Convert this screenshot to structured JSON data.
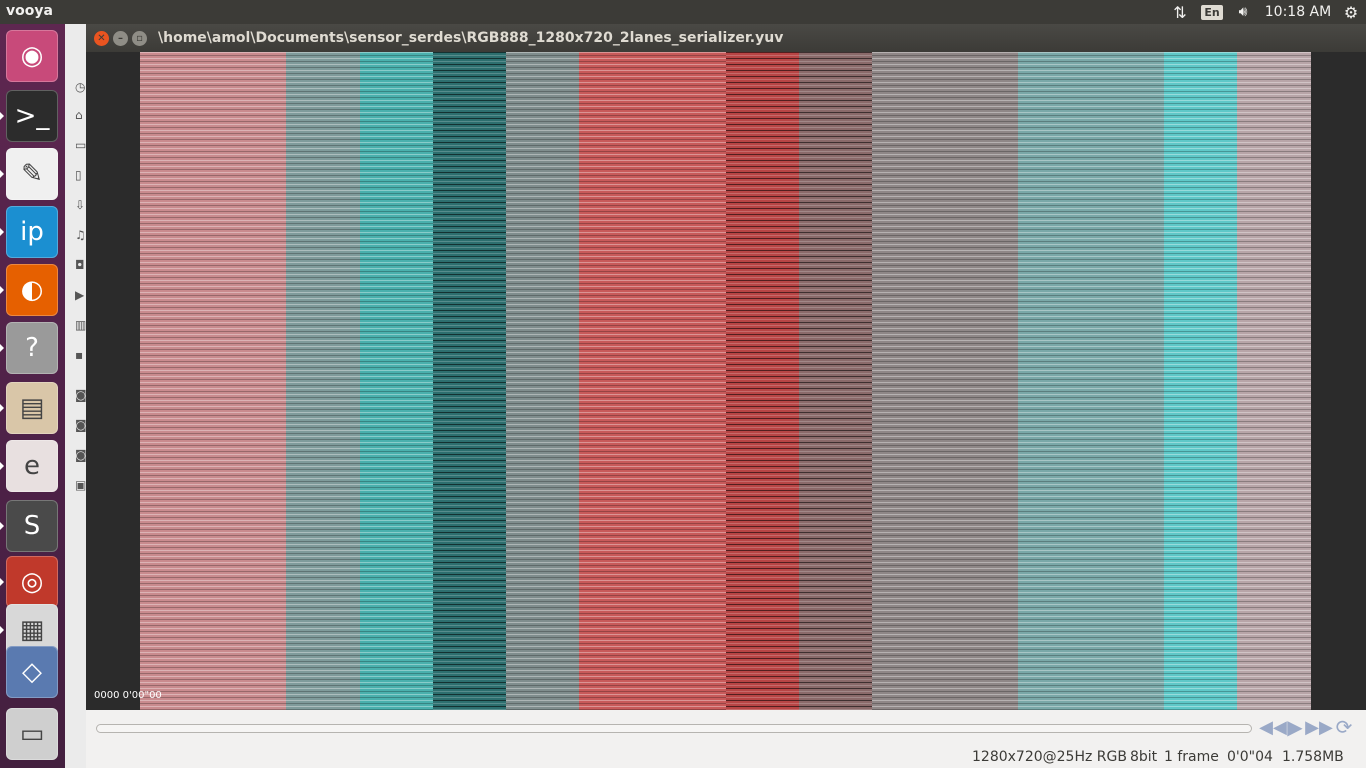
{
  "top_panel": {
    "app_name": "vooya",
    "indicators": {
      "network_icon": "network-updown-icon",
      "language": "En",
      "volume_icon": "volume-icon",
      "clock": "10:18 AM",
      "settings_icon": "gear-icon"
    }
  },
  "launcher": {
    "items": [
      {
        "name": "ubuntu-dash-icon",
        "color": "#c84a7a",
        "glyph": "◉"
      },
      {
        "name": "terminal-icon",
        "color": "#2c2c2c",
        "glyph": ">_"
      },
      {
        "name": "text-editor-icon",
        "color": "#f0f0f0",
        "glyph": "✎"
      },
      {
        "name": "ip-app-icon",
        "color": "#1b8fd1",
        "glyph": "ip"
      },
      {
        "name": "firefox-icon",
        "color": "#e66000",
        "glyph": "◐"
      },
      {
        "name": "help-icon",
        "color": "#9a9a9a",
        "glyph": "?"
      },
      {
        "name": "archive-manager-icon",
        "color": "#d9c6a8",
        "glyph": "▤"
      },
      {
        "name": "document-viewer-icon",
        "color": "#e8e0e0",
        "glyph": "e"
      },
      {
        "name": "sublime-text-icon",
        "color": "#4a4a4a",
        "glyph": "S"
      },
      {
        "name": "disc-burner-icon",
        "color": "#c0392b",
        "glyph": "◎"
      },
      {
        "name": "stacked-apps-icon",
        "color": "#d8d8d8",
        "glyph": "▦"
      },
      {
        "name": "workspaces-icon",
        "color": "#5a7ab0",
        "glyph": "◇"
      },
      {
        "name": "trash-icon",
        "color": "#cfcfcf",
        "glyph": "▭"
      }
    ]
  },
  "window": {
    "title": "\\home\\amol\\Documents\\sensor_serdes\\RGB888_1280x720_2lanes_serializer.yuv",
    "close_icon": "close-icon",
    "minimize_icon": "minimize-icon",
    "maximize_icon": "maximize-icon",
    "frame_bars": [
      {
        "color": "#c98b8e",
        "dark": false
      },
      {
        "color": "#7f9b9b",
        "dark": false
      },
      {
        "color": "#4ab0ad",
        "dark": false
      },
      {
        "color": "#2d6f6f",
        "dark": true
      },
      {
        "color": "#7f8d8d",
        "dark": false
      },
      {
        "color": "#c85a5a",
        "dark": false
      },
      {
        "color": "#b84545",
        "dark": true
      },
      {
        "color": "#8a6a6a",
        "dark": true
      },
      {
        "color": "#8f8787",
        "dark": false
      },
      {
        "color": "#7aa8a8",
        "dark": false
      },
      {
        "color": "#5fc8c8",
        "dark": false
      },
      {
        "color": "#b8a5a8",
        "dark": false
      }
    ],
    "timecode": "0000  0'00\"00",
    "controls": {
      "prev_icon": "rewind-icon",
      "play_icon": "play-icon",
      "next_icon": "fast-forward-icon",
      "loop_icon": "loop-icon"
    },
    "status": {
      "resolution": "1280x720@25Hz RGB",
      "bitdepth": "8bit",
      "frames": "1 frame",
      "time": "0'0\"04",
      "size": "1.758MB"
    }
  }
}
